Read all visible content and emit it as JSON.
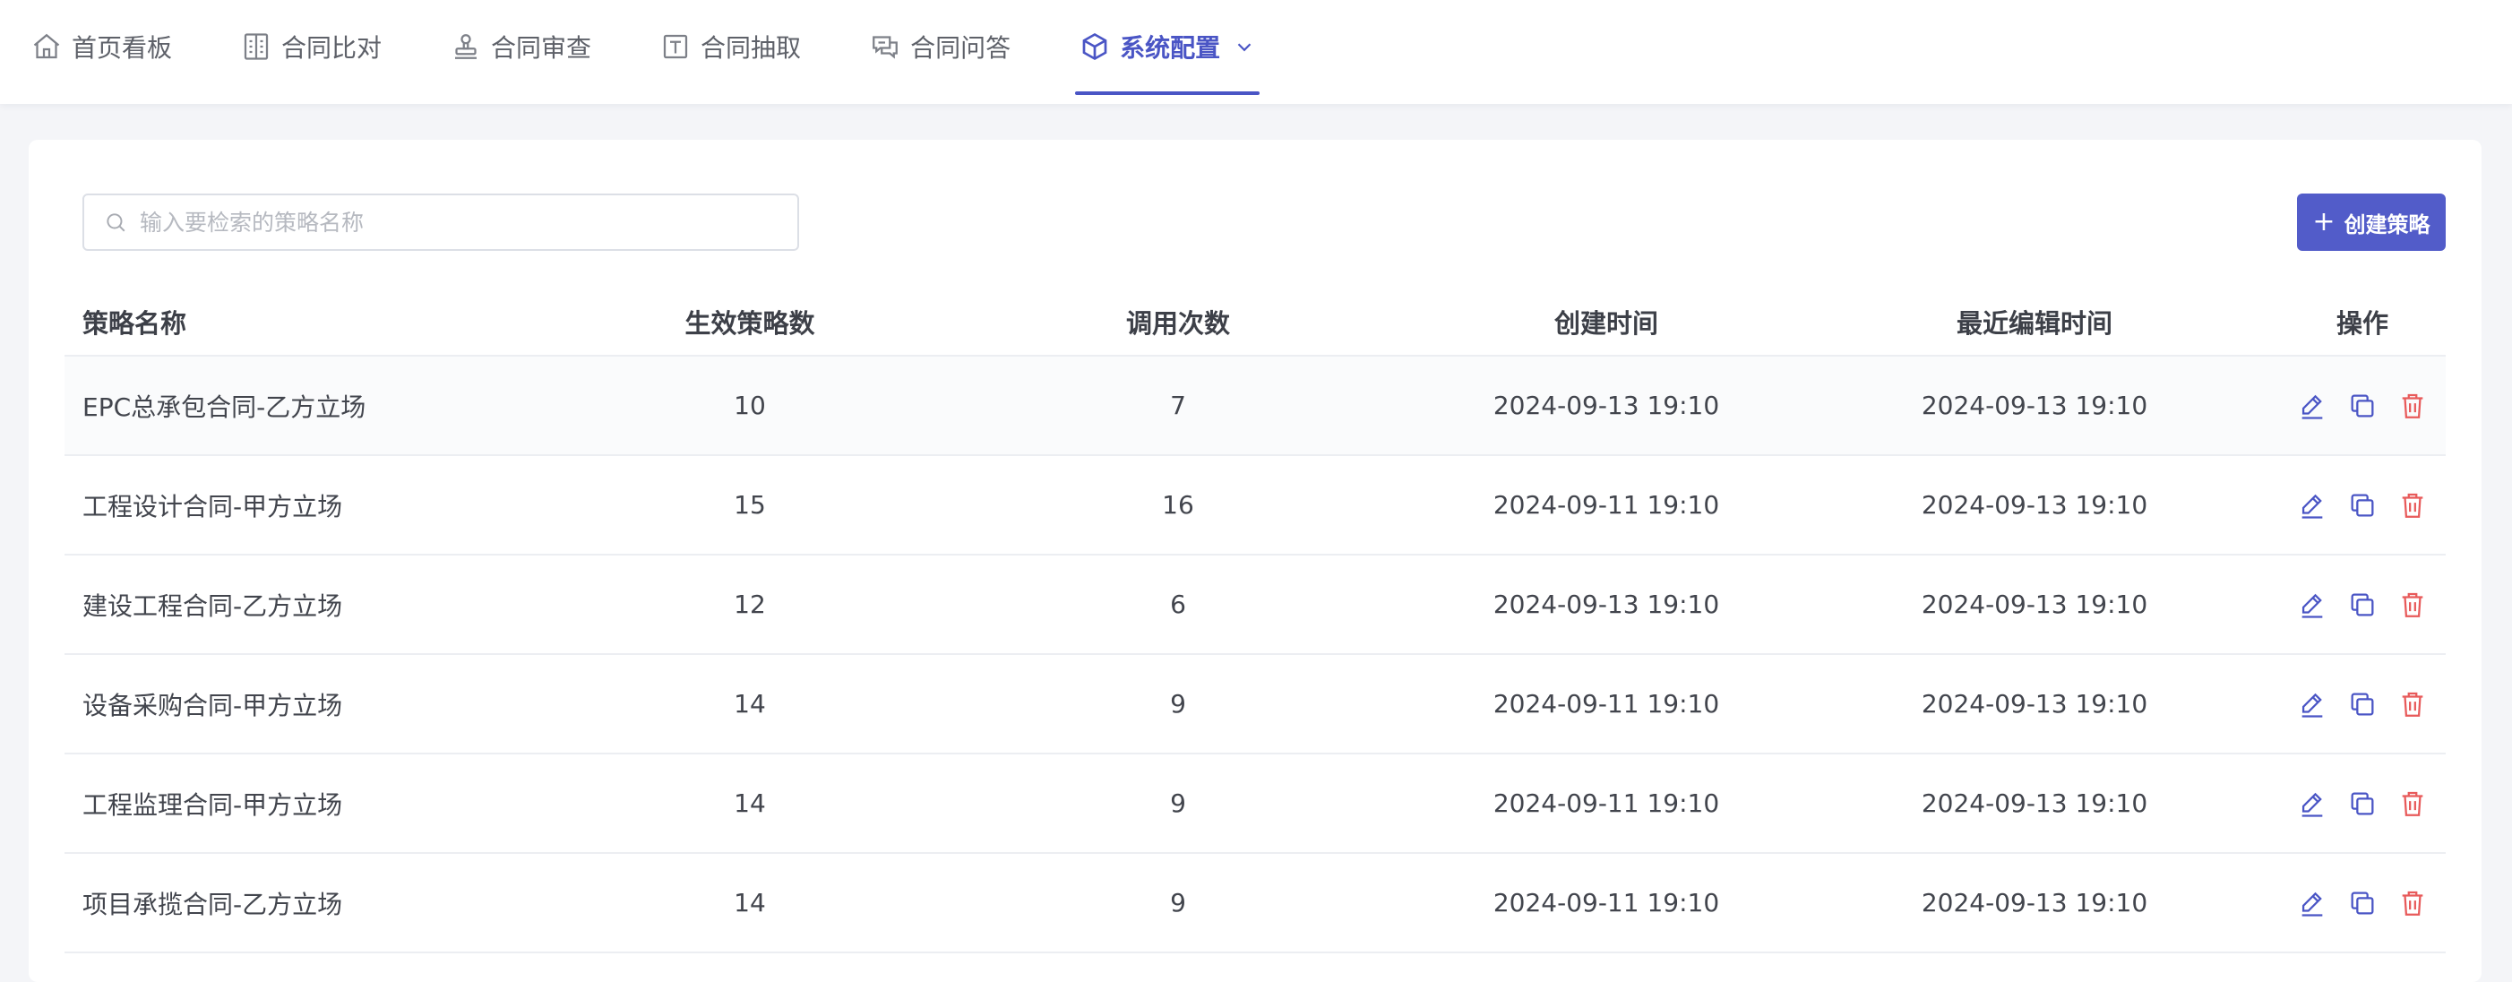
{
  "nav": {
    "items": [
      {
        "label": "首页看板",
        "icon": "home-icon",
        "active": false
      },
      {
        "label": "合同比对",
        "icon": "compare-icon",
        "active": false
      },
      {
        "label": "合同审查",
        "icon": "stamp-icon",
        "active": false
      },
      {
        "label": "合同抽取",
        "icon": "extract-icon",
        "active": false
      },
      {
        "label": "合同问答",
        "icon": "chat-icon",
        "active": false
      },
      {
        "label": "系统配置",
        "icon": "cube-icon",
        "active": true
      }
    ],
    "accent": "#4a55c5"
  },
  "search": {
    "placeholder": "输入要检索的策略名称",
    "value": ""
  },
  "create_button": {
    "label": "创建策略",
    "color": "#525cc9"
  },
  "table": {
    "headers": [
      "策略名称",
      "生效策略数",
      "调用次数",
      "创建时间",
      "最近编辑时间",
      "操作"
    ],
    "rows": [
      {
        "name": "EPC总承包合同-乙方立场",
        "effective": "10",
        "calls": "7",
        "created": "2024-09-13 19:10",
        "edited": "2024-09-13 19:10"
      },
      {
        "name": "工程设计合同-甲方立场",
        "effective": "15",
        "calls": "16",
        "created": "2024-09-11 19:10",
        "edited": "2024-09-13 19:10"
      },
      {
        "name": "建设工程合同-乙方立场",
        "effective": "12",
        "calls": "6",
        "created": "2024-09-13 19:10",
        "edited": "2024-09-13 19:10"
      },
      {
        "name": "设备采购合同-甲方立场",
        "effective": "14",
        "calls": "9",
        "created": "2024-09-11 19:10",
        "edited": "2024-09-13 19:10"
      },
      {
        "name": "工程监理合同-甲方立场",
        "effective": "14",
        "calls": "9",
        "created": "2024-09-11 19:10",
        "edited": "2024-09-13 19:10"
      },
      {
        "name": "项目承揽合同-乙方立场",
        "effective": "14",
        "calls": "9",
        "created": "2024-09-11 19:10",
        "edited": "2024-09-13 19:10"
      }
    ],
    "actions": [
      {
        "icon": "edit-icon",
        "color": "#4a55c5"
      },
      {
        "icon": "copy-icon",
        "color": "#4a55c5"
      },
      {
        "icon": "delete-icon",
        "color": "#e85a5a"
      }
    ]
  }
}
